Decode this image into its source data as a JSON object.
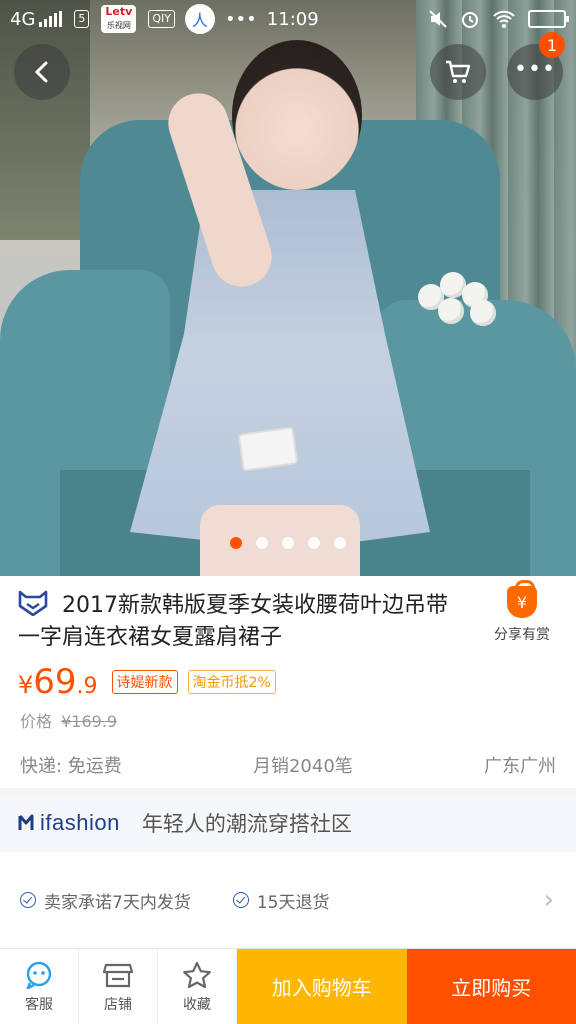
{
  "status_bar": {
    "network": "4G",
    "sim_icon": "sim-icon",
    "app_badge": "Letv",
    "app_badge_sub": "乐视网",
    "iqiyi": "QIY",
    "time": "11:09",
    "more": "•••"
  },
  "nav": {
    "back_icon": "back-icon",
    "cart_icon": "cart-icon",
    "more_icon": "more-icon",
    "more_badge": "1"
  },
  "carousel": {
    "total": 5,
    "active_index": 0
  },
  "product": {
    "title": "2017新款韩版夏季女装收腰荷叶边吊带一字肩连衣裙女夏露肩裙子",
    "share_label": "分享有赏",
    "price_currency": "¥",
    "price_int": "69",
    "price_dec": ".9",
    "tags": [
      "诗媞新款",
      "淘金币抵2%"
    ],
    "orig_label": "价格",
    "orig_price": "¥169.9",
    "shipping": "快递: 免运费",
    "monthly_sales": "月销2040笔",
    "location": "广东广州"
  },
  "ifashion": {
    "logo": "ifashion",
    "tagline": "年轻人的潮流穿搭社区"
  },
  "promises": [
    "卖家承诺7天内发货",
    "15天退货"
  ],
  "bottom_bar": {
    "service": "客服",
    "shop": "店铺",
    "favorite": "收藏",
    "add_cart": "加入购物车",
    "buy_now": "立即购买"
  },
  "colors": {
    "accent": "#ff5000",
    "cart_button": "#ffb600",
    "buy_button": "#ff5000",
    "brand_blue": "#1d3f8a"
  }
}
